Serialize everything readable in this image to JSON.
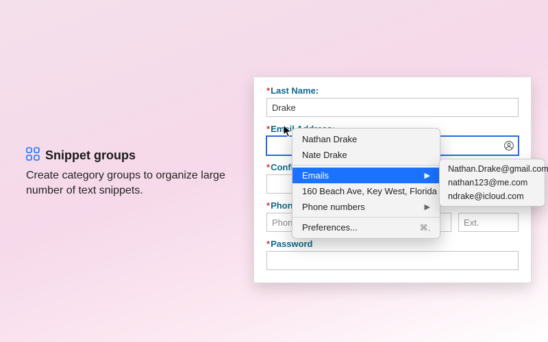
{
  "promo": {
    "title": "Snippet groups",
    "body": "Create category groups to organize large number of text snippets."
  },
  "form": {
    "last_name": {
      "label": "Last Name:",
      "value": "Drake"
    },
    "email": {
      "label": "Email Address:",
      "value": ""
    },
    "confirm": {
      "label": "Confirm Email Address:"
    },
    "phone": {
      "label": "Phone Number:",
      "placeholder": "Phone Number",
      "ext_placeholder": "Ext."
    },
    "password": {
      "label": "Password"
    }
  },
  "menu": {
    "items": [
      {
        "label": "Nathan Drake"
      },
      {
        "label": "Nate Drake"
      }
    ],
    "emails_label": "Emails",
    "address": "160 Beach Ave, Key West, Florida",
    "phone_label": "Phone numbers",
    "prefs_label": "Preferences...",
    "prefs_shortcut": "⌘,"
  },
  "submenu": {
    "items": [
      "Nathan.Drake@gmail.com",
      "nathan123@me.com",
      "ndrake@icloud.com"
    ]
  }
}
